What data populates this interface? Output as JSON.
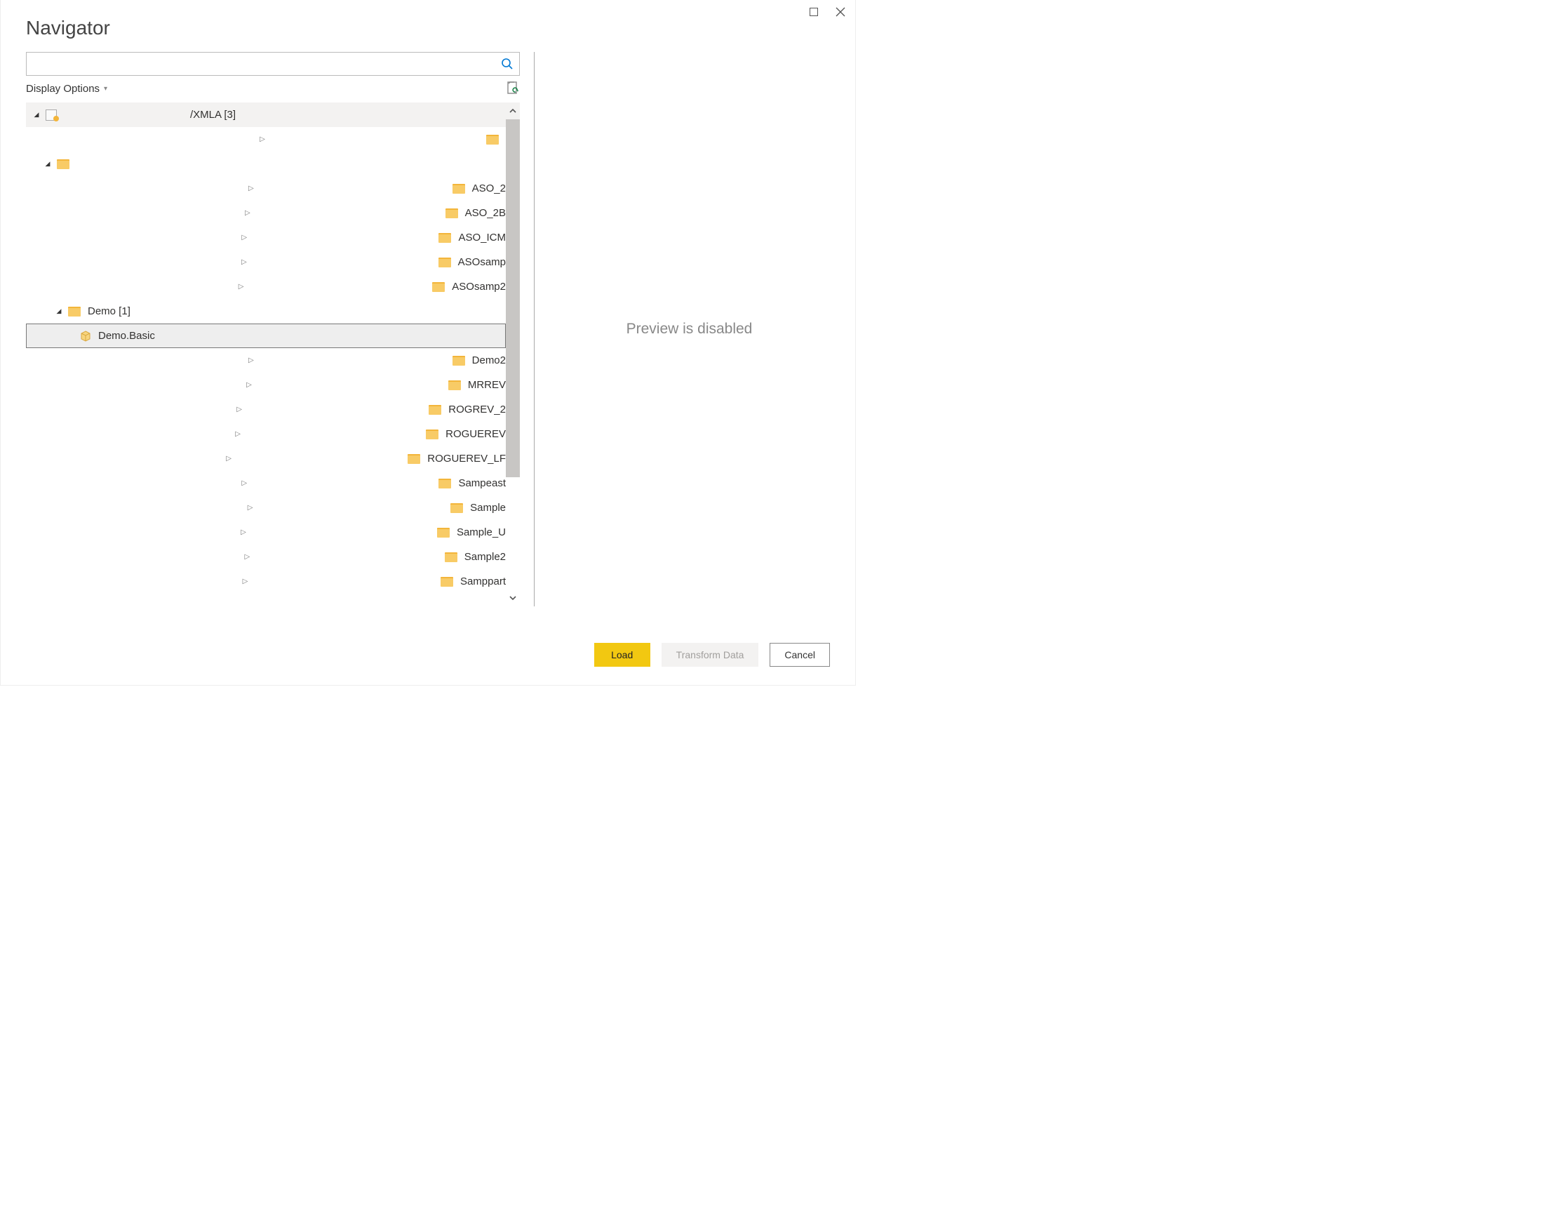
{
  "window": {
    "title": "Navigator"
  },
  "search": {
    "value": "",
    "placeholder": ""
  },
  "options": {
    "displayOptionsLabel": "Display Options"
  },
  "tree": {
    "rootLabel": "/XMLA [3]",
    "items": [
      {
        "label": ""
      },
      {
        "label": ""
      },
      {
        "label": "ASO_2"
      },
      {
        "label": "ASO_2B"
      },
      {
        "label": "ASO_ICM"
      },
      {
        "label": "ASOsamp"
      },
      {
        "label": "ASOsamp2"
      },
      {
        "label": "Demo [1]"
      },
      {
        "label": "Demo.Basic"
      },
      {
        "label": "Demo2"
      },
      {
        "label": "MRREV"
      },
      {
        "label": "ROGREV_2"
      },
      {
        "label": "ROGUEREV"
      },
      {
        "label": "ROGUEREV_LF"
      },
      {
        "label": "Sampeast"
      },
      {
        "label": "Sample"
      },
      {
        "label": "Sample_U"
      },
      {
        "label": "Sample2"
      },
      {
        "label": "Samppart"
      }
    ]
  },
  "preview": {
    "message": "Preview is disabled"
  },
  "footer": {
    "loadLabel": "Load",
    "transformLabel": "Transform Data",
    "cancelLabel": "Cancel"
  }
}
